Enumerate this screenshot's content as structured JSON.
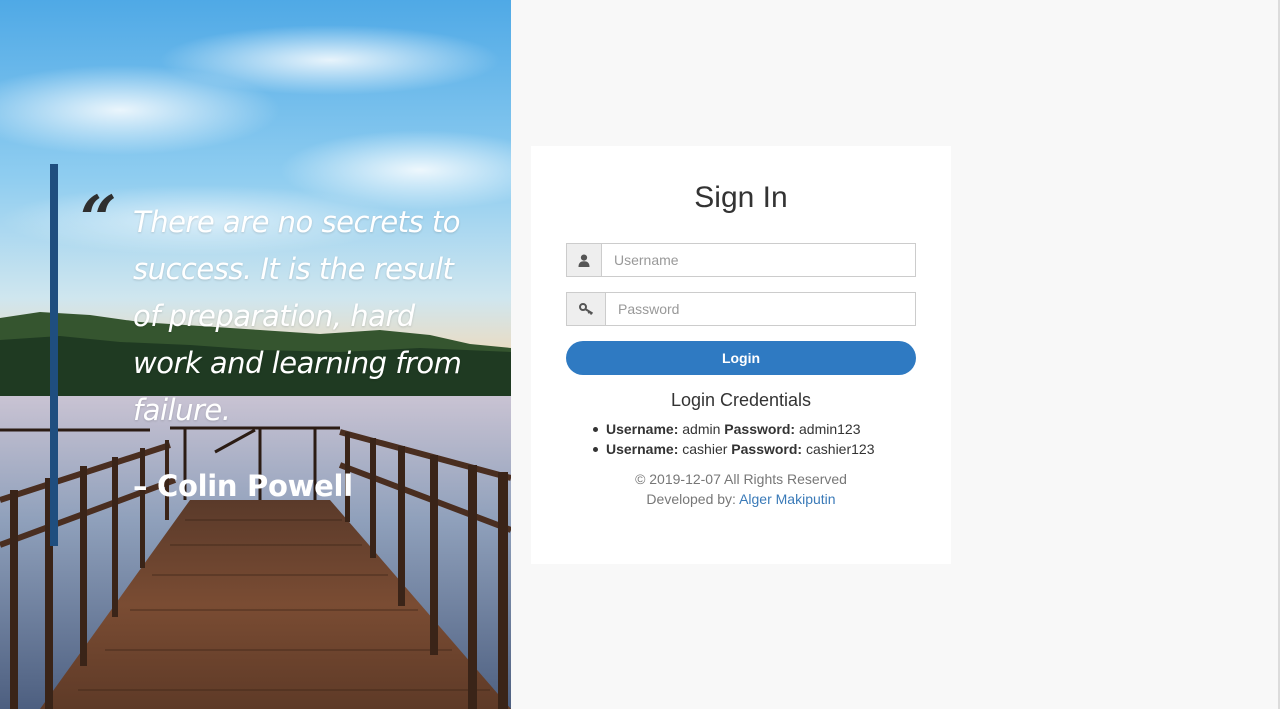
{
  "hero": {
    "quote_mark": "“",
    "quote": "There are no secrets to success. It is the result of preparation, hard work and learning from failure.",
    "author": "– Colin Powell",
    "accent_bar_color": "#1f4e7f"
  },
  "login": {
    "title": "Sign In",
    "username": {
      "placeholder": "Username",
      "value": "",
      "icon": "user-icon"
    },
    "password": {
      "placeholder": "Password",
      "value": "",
      "icon": "key-icon"
    },
    "submit_label": "Login",
    "button_color": "#2f7ac2"
  },
  "credentials": {
    "title": "Login Credentials",
    "items": [
      {
        "username_label": "Username:",
        "username": "admin",
        "password_label": "Password:",
        "password": "admin123"
      },
      {
        "username_label": "Username:",
        "username": "cashier",
        "password_label": "Password:",
        "password": "cashier123"
      }
    ]
  },
  "footer": {
    "copyright": "© 2019-12-07 All Rights Reserved",
    "developed_by_label": "Developed by:",
    "developer_name": "Alger Makiputin",
    "link_color": "#3a7ab8"
  }
}
